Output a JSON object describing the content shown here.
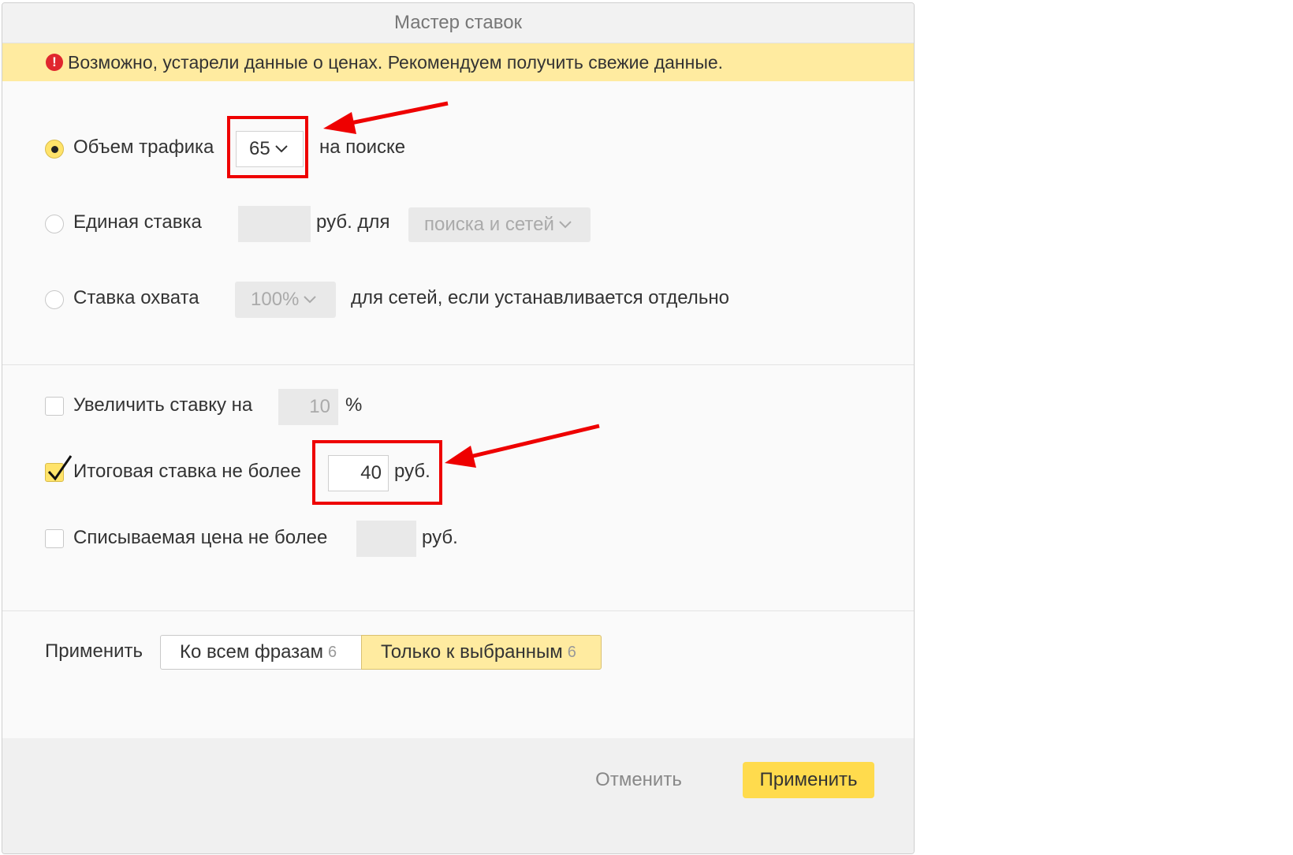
{
  "dialog": {
    "title": "Мастер ставок",
    "warning": "Возможно, устарели данные о ценах. Рекомендуем получить свежие данные."
  },
  "strategy": {
    "traffic": {
      "label": "Объем трафика",
      "value": "65",
      "suffix": "на поиске",
      "selected": true
    },
    "single_bid": {
      "label": "Единая ставка",
      "value": "",
      "unit": "руб. для",
      "target": "поиска и сетей",
      "selected": false
    },
    "coverage": {
      "label": "Ставка охвата",
      "value": "100%",
      "suffix": "для сетей, если устанавливается отдельно",
      "selected": false
    }
  },
  "modifiers": {
    "increase": {
      "label": "Увеличить ставку на",
      "value": "10",
      "unit": "%",
      "checked": false
    },
    "max_bid": {
      "label": "Итоговая ставка не более",
      "value": "40",
      "unit": "руб.",
      "checked": true
    },
    "max_charge": {
      "label": "Списываемая цена не более",
      "value": "",
      "unit": "руб.",
      "checked": false
    }
  },
  "apply_to": {
    "label": "Применить",
    "all": {
      "label": "Ко всем фразам",
      "count": "6"
    },
    "selected": {
      "label": "Только к выбранным",
      "count": "6",
      "active": true
    }
  },
  "footer": {
    "cancel": "Отменить",
    "apply": "Применить"
  },
  "colors": {
    "accent": "#ffdb4d",
    "warning_bg": "#ffeba0",
    "annotation": "#ee0000"
  }
}
